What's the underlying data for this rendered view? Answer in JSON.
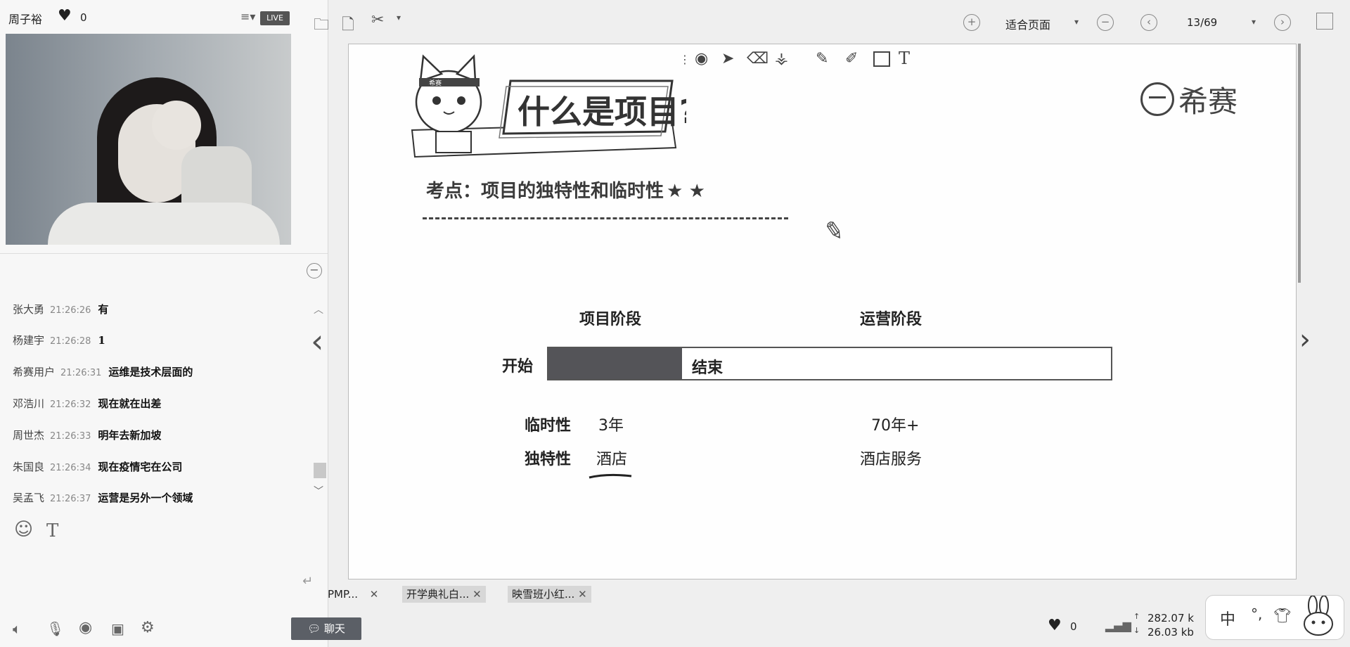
{
  "stream": {
    "user_name": "周子裕",
    "likes": "0",
    "live_badge": "LIVE"
  },
  "chat": {
    "messages": [
      {
        "name": "张大勇",
        "time": "21:26:26",
        "text": "有"
      },
      {
        "name": "杨建宇",
        "time": "21:26:28",
        "text": "1"
      },
      {
        "name": "希赛用户",
        "time": "21:26:31",
        "text": "运维是技术层面的"
      },
      {
        "name": "邓浩川",
        "time": "21:26:32",
        "text": "现在就在出差"
      },
      {
        "name": "周世杰",
        "time": "21:26:33",
        "text": "明年去新加坡"
      },
      {
        "name": "朱国良",
        "time": "21:26:34",
        "text": "现在疫情宅在公司"
      },
      {
        "name": "吴孟飞",
        "time": "21:26:37",
        "text": "运营是另外一个领域"
      }
    ],
    "chat_button": "聊天"
  },
  "toolbar": {
    "fit_mode": "适合页面",
    "page_indicator": "13/69"
  },
  "slide": {
    "badge": "希赛",
    "title": "什么是项目?",
    "logo_text": "希赛",
    "subtitle": "考点：项目的独特性和临时性",
    "stars": "★ ★",
    "phase_project": "项目阶段",
    "phase_operation": "运营阶段",
    "start_label": "开始",
    "end_label": "结束",
    "temp_label": "临时性",
    "temp_project": "3年",
    "temp_operation": "70年+",
    "unique_label": "独特性",
    "unique_project": "酒店",
    "unique_operation": "酒店服务"
  },
  "tabs": [
    {
      "label": "PMP..."
    },
    {
      "label": "开学典礼白..."
    },
    {
      "label": "映雪班小红..."
    }
  ],
  "status": {
    "likes": "0",
    "upload": "282.07 k",
    "download": "26.03 kb"
  },
  "ime": {
    "lang": "中",
    "punct": "°,"
  },
  "colors": {
    "progress_fill": "#545458",
    "live_badge": "#555555",
    "chat_button": "#5b5f66"
  }
}
